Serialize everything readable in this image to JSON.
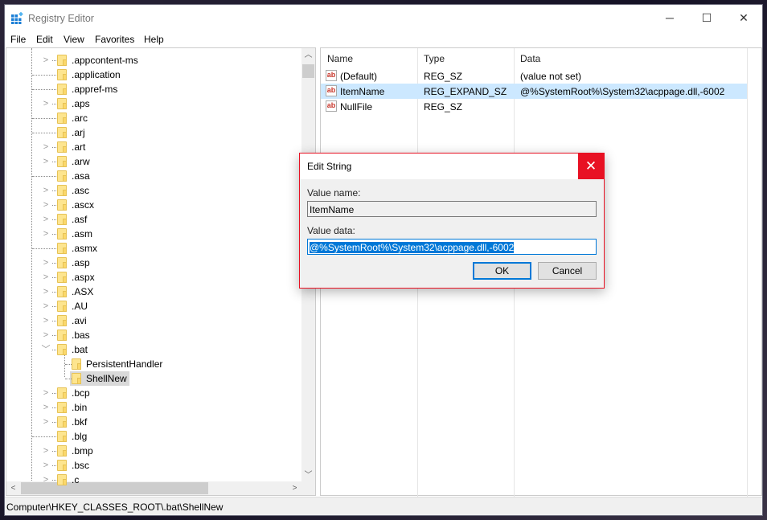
{
  "window": {
    "title": "Registry Editor",
    "controls": {
      "minimize": "─",
      "maximize": "☐",
      "close": "✕"
    }
  },
  "menu": [
    "File",
    "Edit",
    "View",
    "Favorites",
    "Help"
  ],
  "tree": {
    "items": [
      {
        "label": ".appcontent-ms",
        "expander": "collapsed",
        "level": 1
      },
      {
        "label": ".application",
        "expander": "none",
        "level": 1
      },
      {
        "label": ".appref-ms",
        "expander": "none",
        "level": 1
      },
      {
        "label": ".aps",
        "expander": "collapsed",
        "level": 1
      },
      {
        "label": ".arc",
        "expander": "none",
        "level": 1
      },
      {
        "label": ".arj",
        "expander": "none",
        "level": 1
      },
      {
        "label": ".art",
        "expander": "collapsed",
        "level": 1
      },
      {
        "label": ".arw",
        "expander": "collapsed",
        "level": 1
      },
      {
        "label": ".asa",
        "expander": "none",
        "level": 1
      },
      {
        "label": ".asc",
        "expander": "collapsed",
        "level": 1
      },
      {
        "label": ".ascx",
        "expander": "collapsed",
        "level": 1
      },
      {
        "label": ".asf",
        "expander": "collapsed",
        "level": 1
      },
      {
        "label": ".asm",
        "expander": "collapsed",
        "level": 1
      },
      {
        "label": ".asmx",
        "expander": "none",
        "level": 1
      },
      {
        "label": ".asp",
        "expander": "collapsed",
        "level": 1
      },
      {
        "label": ".aspx",
        "expander": "collapsed",
        "level": 1
      },
      {
        "label": ".ASX",
        "expander": "collapsed",
        "level": 1
      },
      {
        "label": ".AU",
        "expander": "collapsed",
        "level": 1
      },
      {
        "label": ".avi",
        "expander": "collapsed",
        "level": 1
      },
      {
        "label": ".bas",
        "expander": "collapsed",
        "level": 1
      },
      {
        "label": ".bat",
        "expander": "expanded",
        "level": 1
      },
      {
        "label": "PersistentHandler",
        "expander": "none",
        "level": 2
      },
      {
        "label": "ShellNew",
        "expander": "none",
        "level": 2,
        "selected": true
      },
      {
        "label": ".bcp",
        "expander": "collapsed",
        "level": 1
      },
      {
        "label": ".bin",
        "expander": "collapsed",
        "level": 1
      },
      {
        "label": ".bkf",
        "expander": "collapsed",
        "level": 1
      },
      {
        "label": ".blg",
        "expander": "none",
        "level": 1
      },
      {
        "label": ".bmp",
        "expander": "collapsed",
        "level": 1
      },
      {
        "label": ".bsc",
        "expander": "collapsed",
        "level": 1
      },
      {
        "label": ".c",
        "expander": "collapsed",
        "level": 1
      }
    ]
  },
  "values": {
    "columns": [
      "Name",
      "Type",
      "Data"
    ],
    "rows": [
      {
        "name": "(Default)",
        "type": "REG_SZ",
        "data": "(value not set)",
        "icon": "string-value-icon"
      },
      {
        "name": "ItemName",
        "type": "REG_EXPAND_SZ",
        "data": "@%SystemRoot%\\System32\\acppage.dll,-6002",
        "icon": "string-value-icon",
        "selected": true
      },
      {
        "name": "NullFile",
        "type": "REG_SZ",
        "data": "",
        "icon": "string-value-icon"
      }
    ]
  },
  "status": "Computer\\HKEY_CLASSES_ROOT\\.bat\\ShellNew",
  "dialog": {
    "title": "Edit String",
    "value_name_label": "Value name:",
    "value_name": "ItemName",
    "value_data_label": "Value data:",
    "value_data": "@%SystemRoot%\\System32\\acppage.dll,-6002",
    "ok": "OK",
    "cancel": "Cancel",
    "close": "✕"
  },
  "colors": {
    "accent": "#0078d7",
    "close_red": "#e81123",
    "selection": "#cce8ff",
    "folder": "#fde58f"
  }
}
